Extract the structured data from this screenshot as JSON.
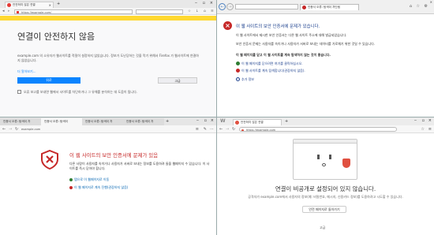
{
  "firefox": {
    "tab_title": "안전하지 않은 연결",
    "url": "https://example.com/",
    "heading": "연결이 안전하지 않음",
    "desc": "example.com 의 소유자가 웹사이트를 적절히 설정하지 않았습니다. 정보가 도난당하는 것을 막기 위해서 Firefox 가 웹사이트에 연결하지 않았습니다.",
    "learn_more": "더 알아보기...",
    "back_button": "뒤로",
    "advanced_button": "고급",
    "report_text": "오류 보고를 보내면 웹에서 사이트를 차단하거나 그 유해를 분석하는 데 도움이 됩니다."
  },
  "ie": {
    "tab_title": "인증서 오류: 탐색이 차단됨",
    "heading": "이 웹 사이트의 보안 인증서에 문제가 있습니다.",
    "p1": "이 웹 사이트에서 제시한 보안 인증서는 다른 웹 사이트 주소에 대해 발급되었습니다.",
    "p2": "보안 인증서 문제는 사용자를 속이거나 사용자가 서버로 보내는 데이터를 가로채기 위한 것일 수 있습니다.",
    "p3": "이 웹 페이지를 닫고 이 웹 사이트를 계속 탐색하지 않는 것이 좋습니다.",
    "close_link": "이 웹 페이지를 닫으려면 여기를 클릭하십시오.",
    "continue_link": "이 웹 사이트를 계속 탐색합니다(권장하지 않음).",
    "more_info": "추가 정보"
  },
  "edge": {
    "tabs": [
      "인증서 오류: 탐색이 차",
      "인증서 오류: 탐색이",
      "인증서 오류: 탐색이 차",
      "인증서 오류: 탐색이 차"
    ],
    "url": "example.com",
    "heading": "이 웹 사이트의 보안 인증서에 문제가 있음",
    "body": "다른 사람이 사용자를 속이거나 사용자가 서버로 보내는 정보를 도용하려 들을 웹페이지 수 있습니다. 이 사이트를 즉시 닫아야 합니다.",
    "close_link": "탭으로 이 웹페이지로 이동",
    "continue_link": "이 웹 페이지로 계속 진행(권장하지 않음)"
  },
  "whale": {
    "tab_title": "안전하지 않은 연결",
    "url": "https://example.com",
    "heading": "연결이 비공개로 설정되어 있지 않습니다.",
    "desc": "공격자가 example.com에서 사용자의 정보(예: 비밀번호, 메시지, 신용카드 정보)를 도용하려고 시도할 수 있습니다.",
    "back_button": "안전 페이지로 돌아가기",
    "details": "고급"
  },
  "colors": {
    "firefox_bar": "#ffd830",
    "ie_red": "#c62828",
    "whale_red": "#e05040",
    "accent_blue": "#1e88e5"
  }
}
